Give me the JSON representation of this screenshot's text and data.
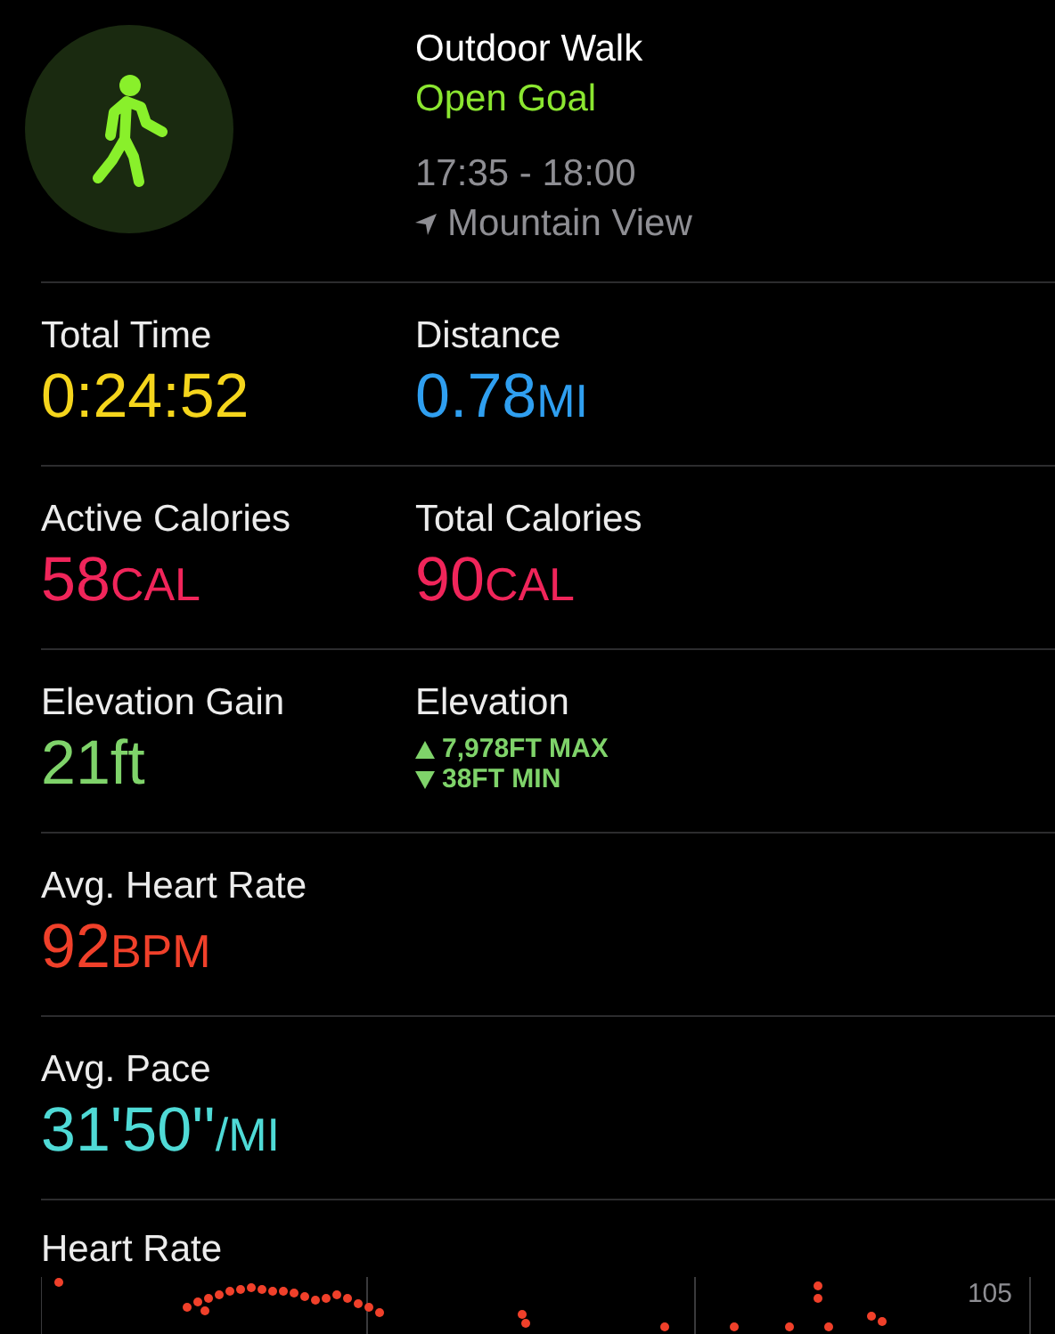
{
  "workout": {
    "title": "Outdoor Walk",
    "goal": "Open Goal",
    "time": "17:35 - 18:00",
    "location": "Mountain View"
  },
  "rows": [
    {
      "cells": [
        {
          "kind": "value",
          "label": "Total Time",
          "value": "0:24:52",
          "color": "#f5d51c"
        },
        {
          "kind": "value",
          "label": "Distance",
          "value": "0.78",
          "unit": "MI",
          "color": "#2f9ff0"
        }
      ]
    },
    {
      "cells": [
        {
          "kind": "value",
          "label": "Active Calories",
          "value": "58",
          "unit": "CAL",
          "color": "#f0255a"
        },
        {
          "kind": "value",
          "label": "Total Calories",
          "value": "90",
          "unit": "CAL",
          "color": "#f0255a"
        }
      ]
    },
    {
      "cells": [
        {
          "kind": "value",
          "label": "Elevation Gain",
          "value": "21ft",
          "color": "#7fd36a"
        },
        {
          "kind": "range",
          "label": "Elevation",
          "max": "7,978FT MAX",
          "min": "38FT MIN",
          "color": "#7fd36a"
        }
      ]
    },
    {
      "cells": [
        {
          "kind": "value",
          "label": "Avg. Heart Rate",
          "value": "92",
          "unit": "BPM",
          "color": "#f0402a"
        }
      ]
    },
    {
      "cells": [
        {
          "kind": "value",
          "label": "Avg. Pace",
          "value": "31'50''",
          "unit": "/MI",
          "color": "#4fdad6"
        }
      ]
    }
  ],
  "heart_rate": {
    "title": "Heart Rate",
    "top_label": "105"
  }
}
